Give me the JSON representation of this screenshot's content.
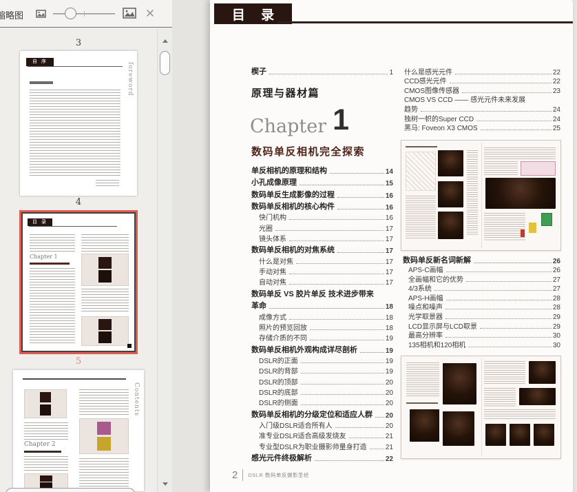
{
  "colors": {
    "selection_ring_red": "#da5c53",
    "selected_label_pink": "#e8837d",
    "header_block_brown": "#2a1611",
    "chapter_title_red": "#4f2419"
  },
  "sidebar": {
    "toolbar": {
      "title": "缩略图"
    },
    "thumbnails": [
      {
        "label": "3",
        "selected": false,
        "header": "自 序",
        "side_text": "foreword"
      },
      {
        "label": "4",
        "selected": true,
        "header": "目 录"
      },
      {
        "label": "5",
        "selected": false,
        "side_text": "Contents",
        "chapter": "Chapter 2"
      }
    ]
  },
  "page": {
    "header": {
      "title": "目 录"
    },
    "intro": {
      "wedge_label": "楔子",
      "wedge_page": "1",
      "part_title": "原理与器材篇",
      "chapter_word": "Chapter",
      "chapter_num": "1",
      "chapter_title": "数码单反相机完全探索"
    },
    "toc_left": [
      {
        "text": "单反相机的原理和结构",
        "page": "14",
        "level": 1
      },
      {
        "text": "小孔成像原理",
        "page": "15",
        "level": 1
      },
      {
        "text": "数码单反生成影像的过程",
        "page": "16",
        "level": 1
      },
      {
        "text": "数码单反相机的核心构件",
        "page": "16",
        "level": 1
      },
      {
        "text": "快门机构",
        "page": "16",
        "level": 2
      },
      {
        "text": "光圈",
        "page": "17",
        "level": 2
      },
      {
        "text": "镜头体系",
        "page": "17",
        "level": 2
      },
      {
        "text": "数码单反相机的对焦系统",
        "page": "17",
        "level": 1
      },
      {
        "text": "什么是对焦",
        "page": "17",
        "level": 2
      },
      {
        "text": "手动对焦",
        "page": "17",
        "level": 2
      },
      {
        "text": "自动对焦",
        "page": "17",
        "level": 2
      },
      {
        "text": "数码单反 VS 胶片单反 技术进步带来",
        "page": "",
        "level": 1
      },
      {
        "text": "革命",
        "page": "18",
        "level": 1
      },
      {
        "text": "成像方式",
        "page": "18",
        "level": 2
      },
      {
        "text": "照片的预览回放",
        "page": "18",
        "level": 2
      },
      {
        "text": "存储介质的不同",
        "page": "19",
        "level": 2
      },
      {
        "text": "数码单反相机外观构成详尽剖析",
        "page": "19",
        "level": 1
      },
      {
        "text": "DSLR的正面",
        "page": "19",
        "level": 2
      },
      {
        "text": "DSLR的背部",
        "page": "19",
        "level": 2
      },
      {
        "text": "DSLR的顶部",
        "page": "20",
        "level": 2
      },
      {
        "text": "DSLR的底部",
        "page": "20",
        "level": 2
      },
      {
        "text": "DSLR的侧面",
        "page": "20",
        "level": 2
      },
      {
        "text": "数码单反相机的分级定位和适应人群",
        "page": "20",
        "level": 1
      },
      {
        "text": "入门级DSLR适合所有人",
        "page": "20",
        "level": 2
      },
      {
        "text": "准专业DSLR适合高级发烧友",
        "page": "21",
        "level": 2
      },
      {
        "text": "专业型DSLR为职业摄影师量身打造",
        "page": "21",
        "level": 2
      },
      {
        "text": "感光元件终极解析",
        "page": "22",
        "level": 1
      }
    ],
    "toc_right_top": [
      {
        "text": "什么是感光元件",
        "page": "22",
        "level": 2
      },
      {
        "text": "CCD感光元件",
        "page": "22",
        "level": 2
      },
      {
        "text": "CMOS图像传感器",
        "page": "23",
        "level": 2
      },
      {
        "text": "CMOS VS CCD —— 感光元件未来发展",
        "page": "",
        "level": 2
      },
      {
        "text": "趋势",
        "page": "24",
        "level": 2
      },
      {
        "text": "独树一帜的Super CCD",
        "page": "24",
        "level": 2
      },
      {
        "text": "黑马: Foveon X3 CMOS",
        "page": "25",
        "level": 2
      }
    ],
    "toc_right_mid": [
      {
        "text": "数码单反新名词新解",
        "page": "26",
        "level": 1
      },
      {
        "text": "APS-C画幅",
        "page": "26",
        "level": 2
      },
      {
        "text": "全画幅和它的优势",
        "page": "27",
        "level": 2
      },
      {
        "text": "4/3系统",
        "page": "27",
        "level": 2
      },
      {
        "text": "APS-H画幅",
        "page": "28",
        "level": 2
      },
      {
        "text": "噪点和噪声",
        "page": "28",
        "level": 2
      },
      {
        "text": "光学取景器",
        "page": "29",
        "level": 2
      },
      {
        "text": "LCD显示屏与LCD取景",
        "page": "29",
        "level": 2
      },
      {
        "text": "最高分辨率",
        "page": "30",
        "level": 2
      },
      {
        "text": "135相机和120相机",
        "page": "30",
        "level": 2
      }
    ],
    "footer": {
      "page_num": "2",
      "book_title": "DSLR 数码单反摄影圣经"
    }
  }
}
